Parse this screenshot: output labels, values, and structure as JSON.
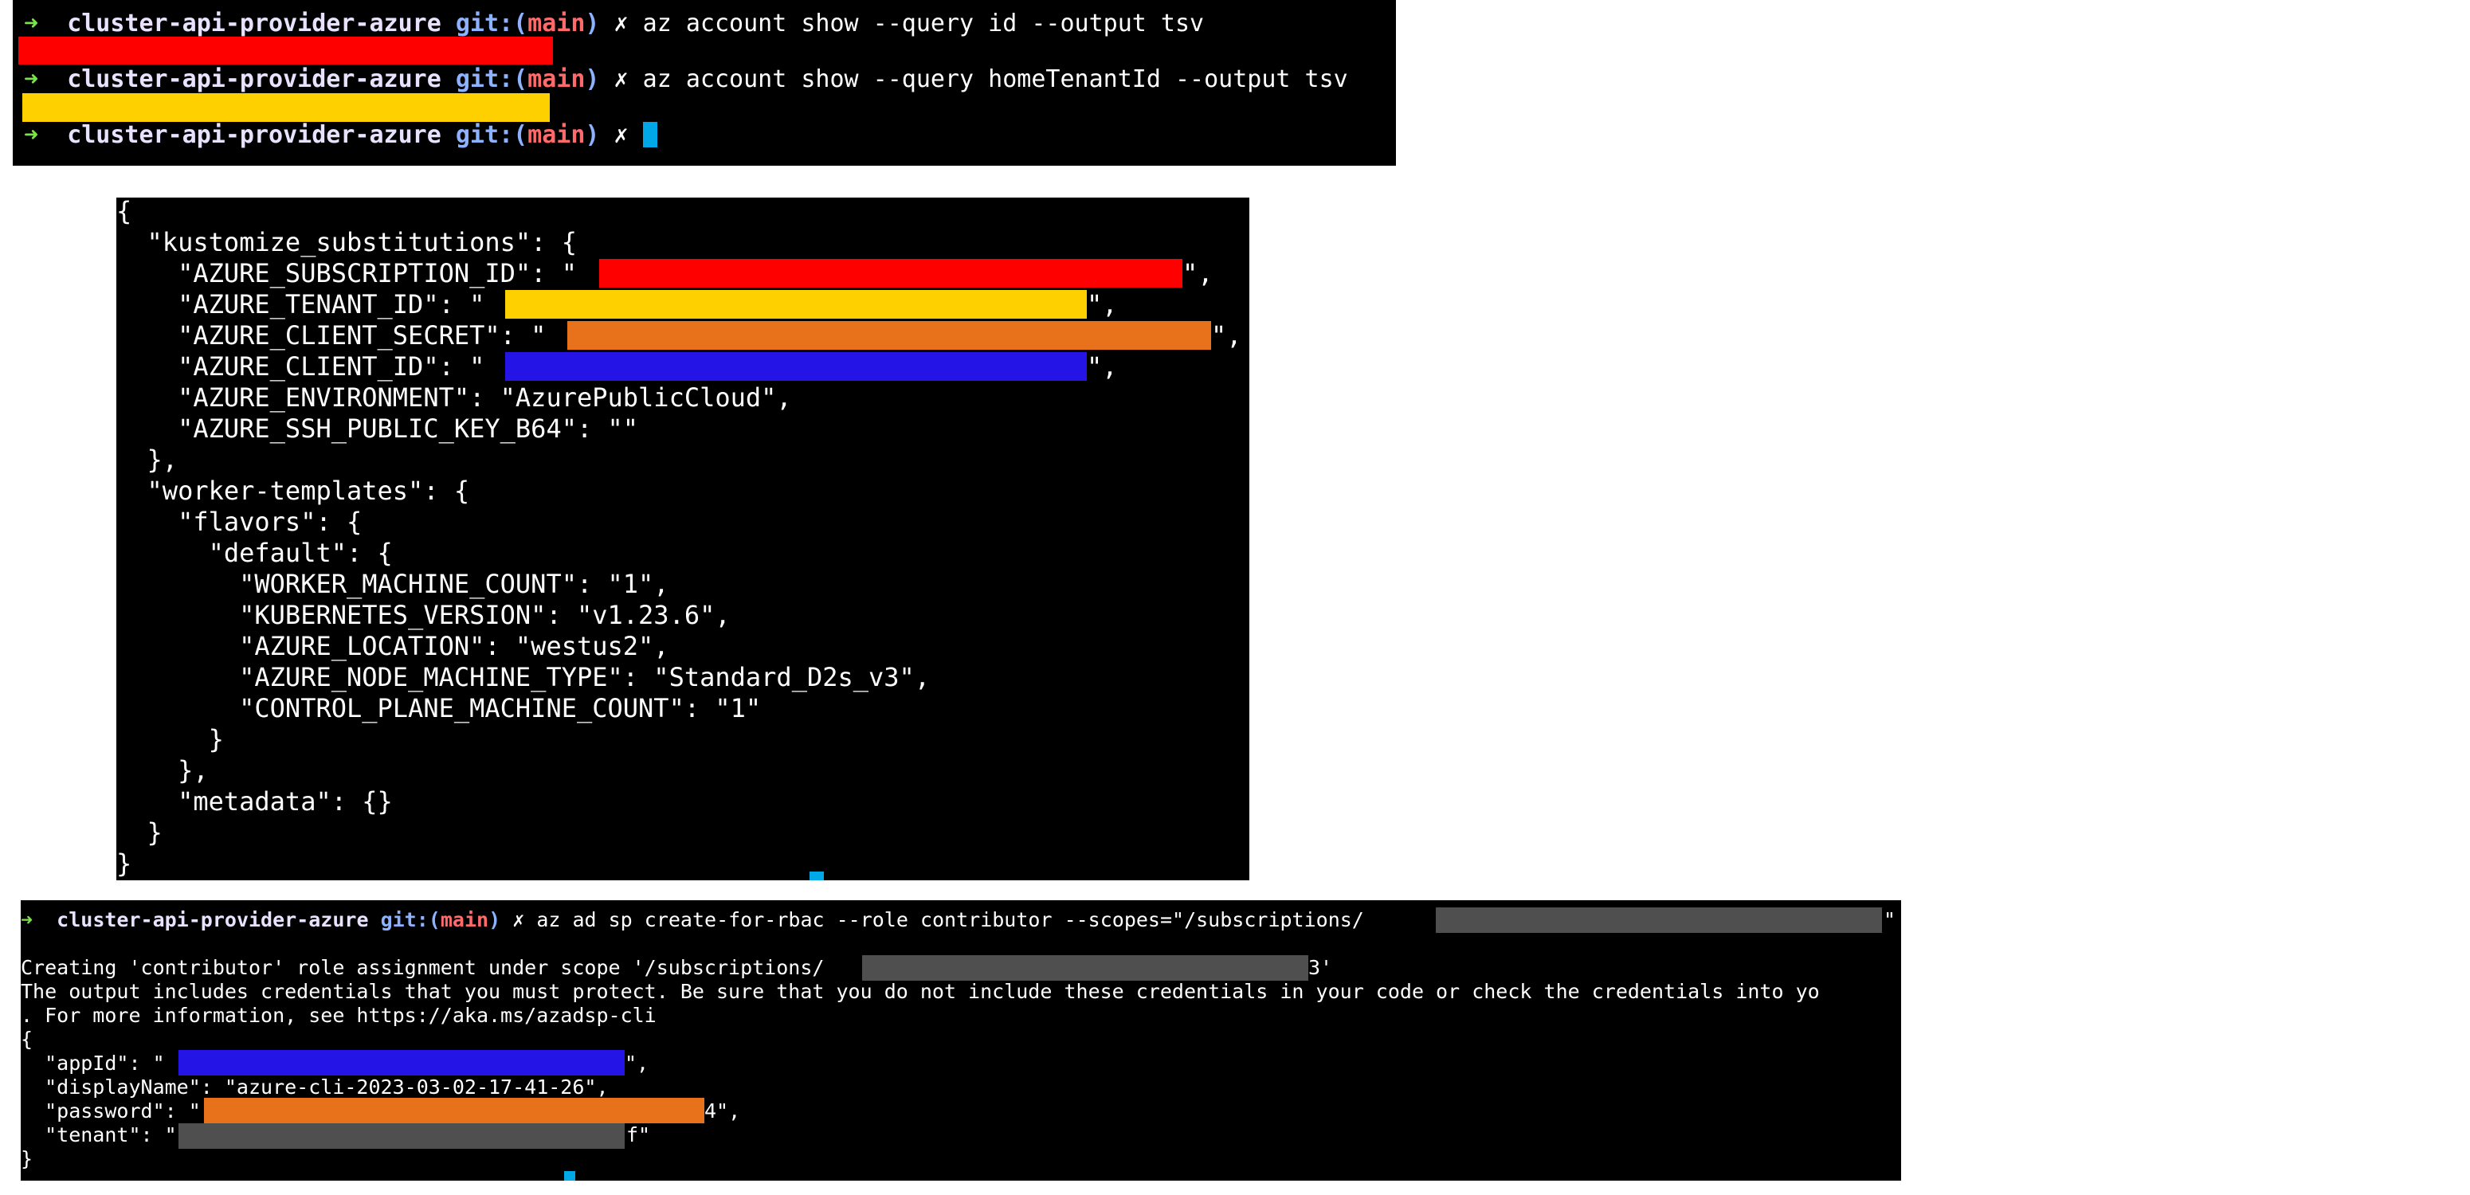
{
  "colors": {
    "redact_red": "#ff0000",
    "redact_yellow": "#ffd000",
    "redact_orange": "#e8711c",
    "redact_blue": "#2414e6",
    "redact_gray": "#4f4f4f",
    "cursor": "#00a8e8",
    "prompt_arrow": "#7ce24a",
    "prompt_branch": "#ff6a6a",
    "prompt_git": "#8db2ff"
  },
  "prompt": {
    "arrow": "➜",
    "dir": "cluster-api-provider-azure",
    "git_open": "git:(",
    "branch": "main",
    "git_close": ")",
    "dirty": "✗"
  },
  "term1": {
    "cmd1": "az account show --query id --output tsv",
    "cmd2": "az account show --query homeTenantId --output tsv"
  },
  "term2": {
    "lines": [
      "{",
      "  \"kustomize_substitutions\": {",
      "    \"AZURE_SUBSCRIPTION_ID\": \"",
      "    \"AZURE_TENANT_ID\": \"",
      "    \"AZURE_CLIENT_SECRET\": \"",
      "    \"AZURE_CLIENT_ID\": \"",
      "    \"AZURE_ENVIRONMENT\": \"AzurePublicCloud\",",
      "    \"AZURE_SSH_PUBLIC_KEY_B64\": \"\"",
      "  },",
      "  \"worker-templates\": {",
      "    \"flavors\": {",
      "      \"default\": {",
      "        \"WORKER_MACHINE_COUNT\": \"1\",",
      "        \"KUBERNETES_VERSION\": \"v1.23.6\",",
      "        \"AZURE_LOCATION\": \"westus2\",",
      "        \"AZURE_NODE_MACHINE_TYPE\": \"Standard_D2s_v3\",",
      "        \"CONTROL_PLANE_MACHINE_COUNT\": \"1\"",
      "      }",
      "    },",
      "    \"metadata\": {}",
      "  }",
      "}"
    ],
    "tail_subscription": "\",",
    "tail_tenant": "\",",
    "tail_secret": "\",",
    "tail_client": "\","
  },
  "term3": {
    "cmd": "az ad sp create-for-rbac --role contributor --scopes=\"/subscriptions/",
    "cmd_tail": "\"",
    "msg1": "Creating 'contributor' role assignment under scope '/subscriptions/",
    "msg1_tail": "3'",
    "msg2": "The output includes credentials that you must protect. Be sure that you do not include these credentials in your code or check the credentials into yo",
    "msg3": ". For more information, see https://aka.ms/azadsp-cli",
    "open": "{",
    "appId_key": "  \"appId\": \"",
    "appId_tail": "\",",
    "displayName_line": "  \"displayName\": \"azure-cli-2023-03-02-17-41-26\",",
    "password_key": "  \"password\": \"",
    "password_tail": "4\",",
    "tenant_key": "  \"tenant\": \"",
    "tenant_tail": "f\"",
    "close": "}"
  }
}
